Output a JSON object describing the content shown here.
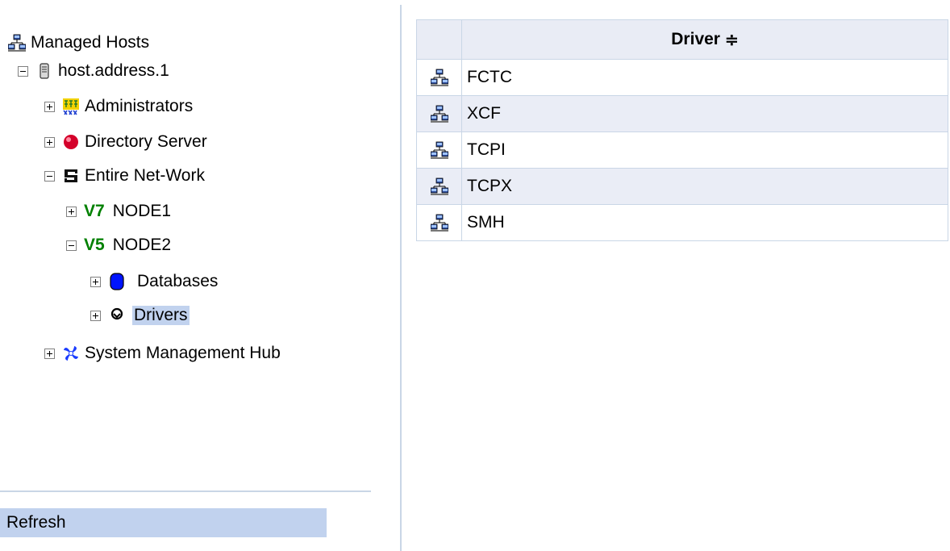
{
  "tree": {
    "root_label": "Managed Hosts",
    "host_label": "host.address.1",
    "administrators_label": "Administrators",
    "directory_server_label": "Directory Server",
    "entire_network_label": "Entire Net-Work",
    "node1_version": "V7",
    "node1_label": "NODE1",
    "node2_version": "V5",
    "node2_label": "NODE2",
    "databases_label": "Databases",
    "drivers_label": "Drivers",
    "smh_label": "System Management Hub",
    "selected": "Drivers"
  },
  "refresh_label": "Refresh",
  "table": {
    "header": "Driver",
    "sort_glyph": "≑",
    "rows": [
      "FCTC",
      "XCF",
      "TCPI",
      "TCPX",
      "SMH"
    ]
  },
  "colors": {
    "selection": "#c1d2ee",
    "version_badge": "#008000",
    "divider": "#c9d6e6",
    "alt_row": "#eaedf6"
  },
  "icons": {
    "root": "network-hosts-icon",
    "host": "server-icon",
    "administrators": "administrators-icon",
    "directory_server": "red-ball-icon",
    "entire_network": "network-icon",
    "databases": "database-icon",
    "drivers": "driver-icon",
    "smh": "smh-icon",
    "row": "network-driver-icon"
  }
}
